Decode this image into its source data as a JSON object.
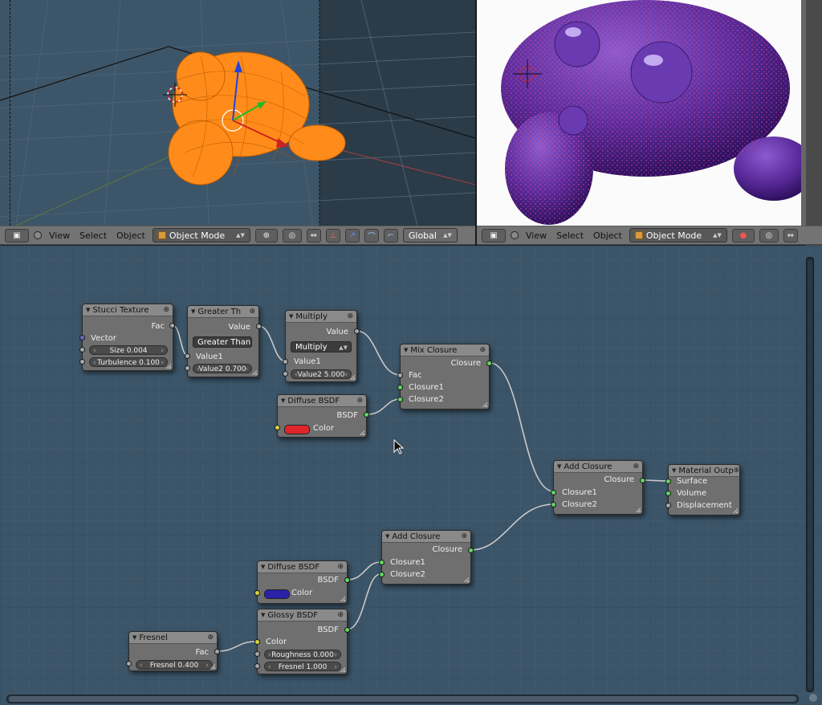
{
  "header_left": {
    "menus": [
      "View",
      "Select",
      "Object"
    ],
    "mode": "Object Mode",
    "orientation": "Global"
  },
  "header_right": {
    "menus": [
      "View",
      "Select",
      "Object"
    ],
    "mode": "Object Mode"
  },
  "nodes": {
    "stucci": {
      "title": "Stucci Texture",
      "out_fac": "Fac",
      "in_vector": "Vector",
      "size": "Size 0.004",
      "turbulence": "Turbulence 0.100"
    },
    "greater": {
      "title": "Greater Th",
      "out_value": "Value",
      "operation": "Greater Than",
      "in_value1": "Value1",
      "value2": "Value2 0.700"
    },
    "multiply": {
      "title": "Multiply",
      "out_value": "Value",
      "operation": "Multiply",
      "in_value1": "Value1",
      "value2": "Value2 5.000"
    },
    "mix": {
      "title": "Mix Closure",
      "out_closure": "Closure",
      "in_fac": "Fac",
      "in_closure1": "Closure1",
      "in_closure2": "Closure2"
    },
    "diffuse_red": {
      "title": "Diffuse BSDF",
      "out_bsdf": "BSDF",
      "color_label": "Color",
      "color": "#e0262a"
    },
    "add_top": {
      "title": "Add Closure",
      "out_closure": "Closure",
      "in_closure1": "Closure1",
      "in_closure2": "Closure2"
    },
    "output": {
      "title": "Material Outp",
      "surface": "Surface",
      "volume": "Volume",
      "displacement": "Displacement"
    },
    "add_bottom": {
      "title": "Add Closure",
      "out_closure": "Closure",
      "in_closure1": "Closure1",
      "in_closure2": "Closure2"
    },
    "diffuse_blue": {
      "title": "Diffuse BSDF",
      "out_bsdf": "BSDF",
      "color_label": "Color",
      "color": "#2a21a8"
    },
    "glossy": {
      "title": "Glossy BSDF",
      "out_bsdf": "BSDF",
      "color_label": "Color",
      "roughness": "Roughness 0.000",
      "fresnel": "Fresnel 1.000"
    },
    "fresnel": {
      "title": "Fresnel",
      "out_fac": "Fac",
      "ior": "Fresnel 0.400"
    }
  },
  "colors": {
    "selection_orange": "#ff8c1a",
    "render_purple": "#5a2a9a",
    "node_bg": "#6f6f6f",
    "editor_bg": "#3b5468"
  }
}
